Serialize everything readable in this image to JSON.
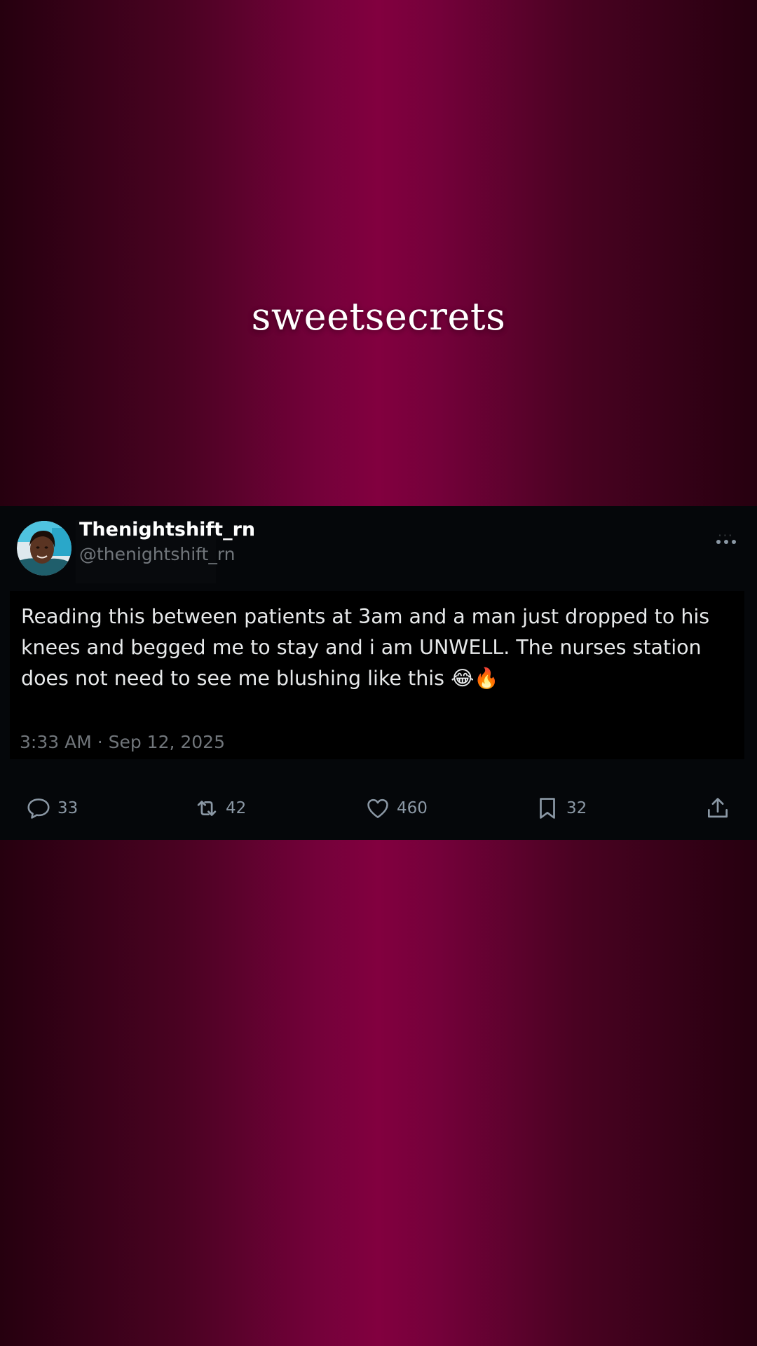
{
  "brand": {
    "title": "sweetsecrets"
  },
  "post": {
    "display_name": "Thenightshift_rn",
    "handle": "@thenightshift_rn",
    "text": "Reading this between patients at 3am and a man just dropped to his knees and begged me to stay and i am UNWELL. The nurses station does not need to see me blushing like this 😂🔥",
    "timestamp": "3:33 AM · Sep 12, 2025",
    "more_icon": "more-horizontal-icon"
  },
  "actions": {
    "replies": {
      "icon": "reply-icon",
      "count": "33"
    },
    "reposts": {
      "icon": "repost-icon",
      "count": "42"
    },
    "likes": {
      "icon": "heart-icon",
      "count": "460"
    },
    "bookmarks": {
      "icon": "bookmark-icon",
      "count": "32"
    },
    "share": {
      "icon": "share-icon"
    }
  },
  "colors": {
    "background_center": "#82003f",
    "background_edge": "#26000f",
    "card": "#05070a",
    "text_primary": "#e7e9ea",
    "text_secondary": "#71767b",
    "icon": "#8b98a5"
  }
}
